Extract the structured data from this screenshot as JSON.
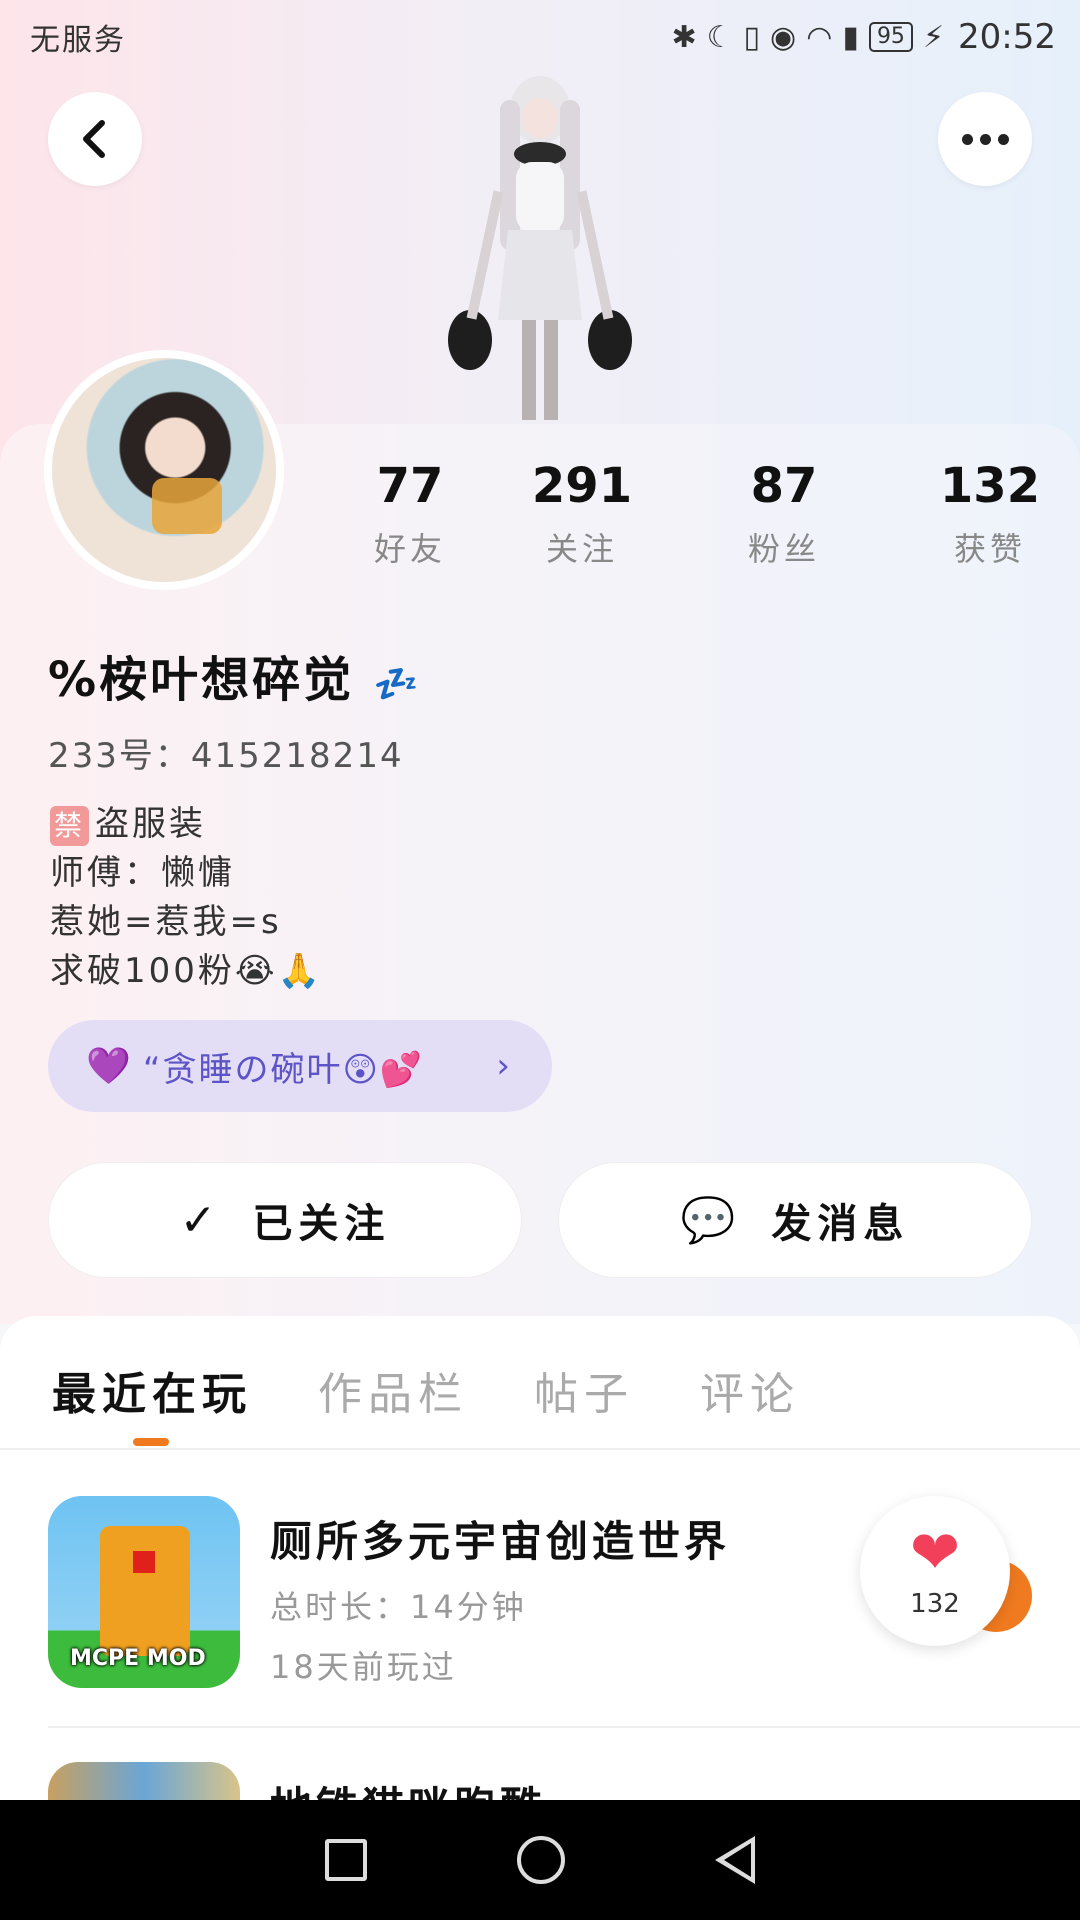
{
  "status_bar": {
    "carrier": "无服务",
    "battery": "95",
    "time": "20:52",
    "icons": [
      "bluetooth-icon",
      "vibrate-icon",
      "moon-icon",
      "eye-icon",
      "wifi-icon",
      "sim-alert-icon",
      "charging-icon"
    ]
  },
  "profile": {
    "stats": [
      {
        "value": "77",
        "label": "好友"
      },
      {
        "value": "291",
        "label": "关注"
      },
      {
        "value": "87",
        "label": "粉丝"
      },
      {
        "value": "132",
        "label": "获赞"
      }
    ],
    "name": "%桉叶想碎觉",
    "name_emoji": "💤",
    "uid": "233号：415218214",
    "bio": {
      "ban_badge": "禁",
      "line1": "盗服装",
      "line2": "师傅：懒慵",
      "line3": "惹她=惹我=s",
      "line4": "求破100粉😭🙏"
    },
    "tag": {
      "heart": "💜",
      "text": "“贪睡の碗叶😲💕",
      "arrow": "›"
    }
  },
  "actions": {
    "follow_label": "已关注",
    "follow_icon": "✓",
    "message_label": "发消息",
    "message_icon": "💬"
  },
  "tabs": [
    {
      "label": "最近在玩",
      "active": true
    },
    {
      "label": "作品栏",
      "active": false
    },
    {
      "label": "帖子",
      "active": false
    },
    {
      "label": "评论",
      "active": false
    }
  ],
  "games": [
    {
      "title": "厕所多元宇宙创造世界",
      "thumb_label": "MCPE MOD",
      "duration": "总时长：14分钟",
      "last_played": "18天前玩过"
    },
    {
      "title": "地铁猫咪跑酷"
    }
  ],
  "likes": {
    "count": "132"
  },
  "colors": {
    "accent": "#f07a1f",
    "tag_bg": "#e3ddf6",
    "tag_text": "#5d55c7",
    "heart": "#f2405a"
  }
}
